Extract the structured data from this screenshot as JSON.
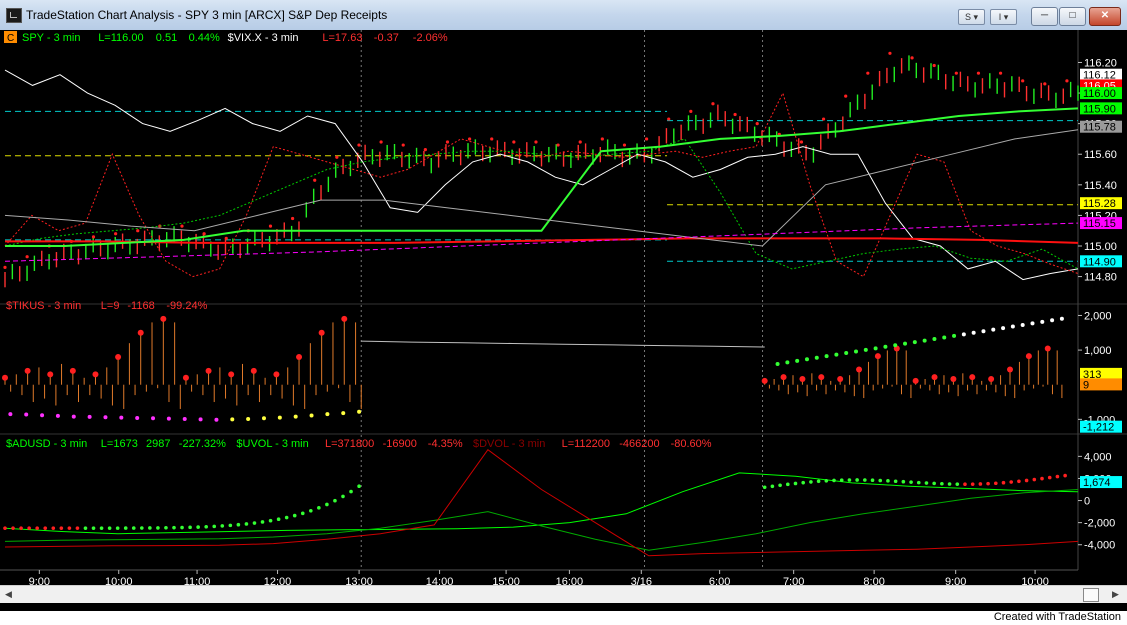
{
  "window": {
    "title": "TradeStation Chart Analysis - SPY 3 min [ARCX] S&P Dep Receipts",
    "buttons": {
      "s_label": "S",
      "i_label": "I",
      "minimize": "─",
      "maximize": "□",
      "close": "✕"
    }
  },
  "footer": {
    "credit": "Created with TradeStation"
  },
  "chart_data": [
    {
      "type": "line",
      "pane": "price",
      "badge": "C",
      "legend": [
        {
          "text": "SPY - 3 min",
          "color": "#00ff00"
        },
        {
          "text": "L=116.00",
          "color": "#00ff00"
        },
        {
          "text": "0.51",
          "color": "#00ff00"
        },
        {
          "text": "0.44%",
          "color": "#00ff00"
        },
        {
          "text": "$VIX.X - 3 min",
          "color": "#ffffff"
        },
        {
          "text": "L=17.63",
          "color": "#ff3030"
        },
        {
          "text": "-0.37",
          "color": "#ff3030"
        },
        {
          "text": "-2.06%",
          "color": "#ff3030"
        }
      ],
      "ylim": [
        114.66,
        116.36
      ],
      "y_ticks": [
        "116.20",
        "116.00",
        "115.80",
        "115.60",
        "115.40",
        "115.20",
        "115.00",
        "114.80"
      ],
      "y_tick_values": [
        116.2,
        116.0,
        115.8,
        115.6,
        115.4,
        115.2,
        115.0,
        114.8
      ],
      "y_markers": [
        {
          "label": "116.12",
          "value": 116.12,
          "bg": "#ffffff",
          "fg": "#000000"
        },
        {
          "label": "116.05",
          "value": 116.05,
          "bg": "#ff0000",
          "fg": "#ffffff"
        },
        {
          "label": "116.00",
          "value": 116.0,
          "bg": "#00ff00",
          "fg": "#000000"
        },
        {
          "label": "115.90",
          "value": 115.9,
          "bg": "#00ff00",
          "fg": "#000000"
        },
        {
          "label": "115.78",
          "value": 115.78,
          "bg": "#9a9a9a",
          "fg": "#000000"
        },
        {
          "label": "115.28",
          "value": 115.28,
          "bg": "#ffff00",
          "fg": "#000000"
        },
        {
          "label": "115.15",
          "value": 115.15,
          "bg": "#ff00ff",
          "fg": "#000000"
        },
        {
          "label": "114.90",
          "value": 114.9,
          "bg": "#00ffff",
          "fg": "#000000"
        }
      ],
      "hlines": [
        {
          "value": 115.88,
          "x0": 0,
          "x1": 0.617,
          "color": "#00cccc"
        },
        {
          "value": 115.82,
          "x0": 0.617,
          "x1": 1.0,
          "color": "#00cccc"
        },
        {
          "value": 115.59,
          "x0": 0,
          "x1": 0.617,
          "color": "#dddd00"
        },
        {
          "value": 115.27,
          "x0": 0.617,
          "x1": 1.0,
          "color": "#dddd00"
        },
        {
          "value": 115.04,
          "x0": 0,
          "x1": 0.617,
          "color": "#00cccc"
        },
        {
          "value": 114.9,
          "x0": 0.617,
          "x1": 1.0,
          "color": "#00cccc"
        }
      ],
      "series": [
        {
          "kind": "ohlc",
          "values": [
            114.78,
            114.85,
            114.92,
            114.95,
            114.98,
            115.0,
            115.02,
            115.05,
            115.05,
            115.0,
            114.97,
            115.02,
            115.05,
            115.1,
            115.35,
            115.5,
            115.58,
            115.6,
            115.58,
            115.55,
            115.6,
            115.62,
            115.62,
            115.6,
            115.6,
            115.58,
            115.6,
            115.62,
            115.58,
            115.62,
            115.75,
            115.8,
            115.85,
            115.78,
            115.72,
            115.65,
            115.6,
            115.75,
            115.9,
            116.05,
            116.18,
            116.15,
            116.1,
            116.05,
            116.05,
            116.05,
            116.0,
            115.98,
            116.0
          ]
        },
        {
          "name": "$VIX.X",
          "kind": "line",
          "color": "#ffffff",
          "values": [
            116.15,
            116.05,
            116.12,
            116.0,
            115.92,
            115.8,
            115.75,
            115.82,
            115.9,
            115.8,
            115.75,
            115.85,
            115.8,
            115.55,
            115.25,
            115.22,
            115.4,
            115.55,
            115.6,
            115.55,
            115.45,
            115.4,
            115.5,
            115.6,
            115.55,
            115.45,
            115.5,
            115.58,
            115.6,
            115.65,
            115.6,
            115.6,
            115.28,
            115.05,
            115.0,
            114.85,
            114.9,
            114.78,
            114.82,
            114.85
          ]
        },
        {
          "kind": "line",
          "color": "#ff2020",
          "style": "dotted",
          "values": [
            115.0,
            115.2,
            115.1,
            115.15,
            115.6,
            115.2,
            114.9,
            114.8,
            114.85,
            115.2,
            115.65,
            115.6,
            115.55,
            115.5,
            115.45,
            115.5,
            115.6,
            115.7,
            115.65,
            115.6,
            115.58,
            115.62,
            115.6,
            115.58,
            115.6,
            115.62,
            115.58,
            115.62,
            115.65,
            116.0,
            115.4,
            114.9,
            114.8,
            115.2,
            115.6,
            115.55,
            115.1,
            115.0,
            114.95,
            114.88,
            114.82
          ]
        },
        {
          "kind": "line",
          "color": "#00cc00",
          "style": "dotted",
          "values": [
            115.0,
            115.05,
            115.08,
            115.1,
            115.12,
            115.15,
            115.2,
            115.3,
            115.4,
            115.5,
            115.55,
            115.58,
            115.6,
            115.62,
            115.62,
            115.6,
            115.58,
            115.6,
            115.62,
            115.7,
            115.35,
            114.95,
            114.85,
            114.9,
            114.95,
            114.98,
            115.0,
            114.92,
            114.9,
            114.98,
            114.85
          ]
        },
        {
          "kind": "line",
          "color": "#ff1010",
          "width": 2,
          "values": [
            115.03,
            115.03,
            115.02,
            115.02,
            115.02,
            115.03,
            115.04,
            115.05,
            115.05,
            115.05,
            115.04,
            115.02
          ]
        },
        {
          "kind": "line",
          "color": "#33ff33",
          "width": 2,
          "values": [
            115.0,
            115.0,
            115.02,
            115.04,
            115.1,
            115.1,
            115.1,
            115.1,
            115.1,
            115.1,
            115.62,
            115.65,
            115.7,
            115.72,
            115.75,
            115.8,
            115.85,
            115.88,
            115.9
          ]
        },
        {
          "kind": "line",
          "color": "#aaaaaa",
          "values": [
            115.2,
            115.17,
            115.13,
            115.1,
            115.2,
            115.3,
            115.3,
            115.25,
            115.2,
            115.15,
            115.1,
            115.05,
            115.0,
            115.4,
            115.5,
            115.6,
            115.7,
            115.76
          ]
        },
        {
          "kind": "line",
          "color": "#ff00ff",
          "style": "dashed",
          "values": [
            114.9,
            114.93,
            114.96,
            115.0,
            115.04,
            115.08,
            115.12,
            115.15
          ]
        }
      ]
    },
    {
      "type": "line",
      "pane": "tikus",
      "legend": [
        {
          "text": "$TIKUS - 3 min",
          "color": "#ff3030"
        },
        {
          "text": "L=9",
          "color": "#ff3030"
        },
        {
          "text": "-1168",
          "color": "#ff3030"
        },
        {
          "text": "-99.24%",
          "color": "#ff3030"
        }
      ],
      "ylim": [
        -1250,
        2100
      ],
      "y_ticks": [
        "2,000",
        "1,000",
        "-1,000"
      ],
      "y_tick_values": [
        2000,
        1000,
        -1000
      ],
      "y_markers": [
        {
          "label": "313",
          "value": 313,
          "bg": "#ffff00",
          "fg": "#000000"
        },
        {
          "label": "9",
          "value": 9,
          "bg": "#ff8c00",
          "fg": "#000000"
        },
        {
          "label": "-1,212",
          "value": -1212,
          "bg": "#00ffff",
          "fg": "#000000"
        }
      ],
      "series": [
        {
          "name": "osc",
          "kind": "oscillator",
          "color": "#e07a2a",
          "values": [
            200,
            -200,
            300,
            -300,
            400,
            -500,
            500,
            -400,
            300,
            -600,
            600,
            -300,
            400,
            -500,
            200,
            -300,
            300,
            -400,
            500,
            -600,
            800,
            -700,
            1200,
            -300,
            1500,
            -200,
            1800,
            -100,
            1900,
            -500,
            1800,
            -700
          ]
        },
        {
          "name": "magenta-dots",
          "kind": "dots",
          "color": "#ff30ff",
          "values": [
            -850,
            -860,
            -880,
            -900,
            -920,
            -930,
            -940,
            -950,
            -960,
            -970,
            -980,
            -990,
            -1000,
            -1010,
            -1000,
            -990,
            -970,
            -950,
            -920,
            -890,
            -850,
            -820,
            -780
          ]
        },
        {
          "name": "white-line",
          "kind": "line",
          "color": "#c0c0c0",
          "values": [
            1260,
            1230,
            1210,
            1190,
            1170,
            1150,
            1130,
            1110,
            1090
          ]
        }
      ]
    },
    {
      "type": "line",
      "pane": "adusd",
      "legend": [
        {
          "text": "$ADUSD - 3 min",
          "color": "#00ff00"
        },
        {
          "text": "L=1673",
          "color": "#00ff00"
        },
        {
          "text": "2987",
          "color": "#00ff00"
        },
        {
          "text": "-227.32%",
          "color": "#00ff00"
        },
        {
          "text": "$UVOL - 3 min",
          "color": "#00ff00"
        },
        {
          "text": "L=371800",
          "color": "#ff3030"
        },
        {
          "text": "-16900",
          "color": "#ff3030"
        },
        {
          "text": "-4.35%",
          "color": "#ff3030"
        },
        {
          "text": "$DVOL - 3 min",
          "color": "#8b0000"
        },
        {
          "text": "L=112200",
          "color": "#ff3030"
        },
        {
          "text": "-466200",
          "color": "#ff3030"
        },
        {
          "text": "-80.60%",
          "color": "#ff3030"
        }
      ],
      "ylim": [
        -5200,
        5300
      ],
      "y_ticks": [
        "4,000",
        "2,000",
        "0",
        "-2,000",
        "-4,000"
      ],
      "y_tick_values": [
        4000,
        2000,
        0,
        -2000,
        -4000
      ],
      "y_markers": [
        {
          "label": "1,674",
          "value": 1674,
          "bg": "#00ffff",
          "fg": "#000000"
        }
      ],
      "series": [
        {
          "name": "$ADUSD",
          "kind": "line",
          "color": "#00ff00",
          "values": [
            -2500,
            -2800,
            -3000,
            -2900,
            -2800,
            -2700,
            -2650,
            -2600,
            -2550,
            -2400,
            -2000,
            -1200,
            800,
            2500,
            2200,
            1600,
            1300,
            1100,
            900,
            800
          ]
        },
        {
          "name": "$UVOL",
          "kind": "line",
          "color": "#00aa00",
          "values": [
            -3700,
            -3600,
            -3550,
            -3500,
            -3450,
            -3300,
            -3000,
            -2500,
            -1800,
            -1000,
            -2300,
            -3500,
            -4500,
            -3800,
            -3000,
            -2000,
            -1200,
            -500,
            200,
            700,
            1000
          ]
        },
        {
          "name": "$DVOL",
          "kind": "line",
          "color": "#cc0000",
          "values": [
            -4200,
            -4150,
            -4100,
            -4080,
            -4050,
            -3900,
            -3500,
            -3000,
            -2200,
            4600,
            1000,
            -2000,
            -5000,
            -4800,
            -4700,
            -4600,
            -4500,
            -4400,
            -4200,
            -4000,
            -3700
          ]
        }
      ]
    }
  ],
  "x_axis": {
    "labels": [
      "9:00",
      "10:00",
      "11:00",
      "12:00",
      "13:00",
      "14:00",
      "15:00",
      "16:00",
      "3/16",
      "6:00",
      "7:00",
      "8:00",
      "9:00",
      "10:00"
    ],
    "session_breaks": [
      "13:00",
      "3/16",
      "6:00"
    ]
  }
}
